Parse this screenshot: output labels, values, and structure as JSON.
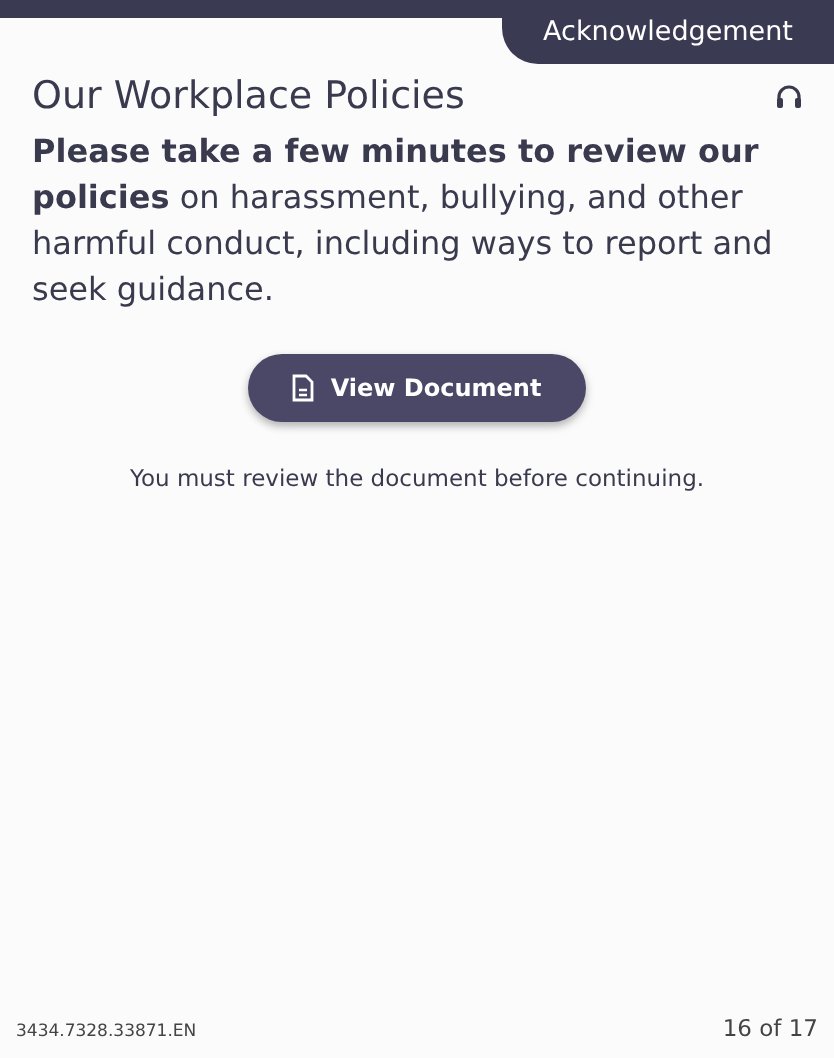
{
  "header": {
    "tab": "Acknowledgement"
  },
  "title": "Our Workplace Policies",
  "intro": "**Please take a few minutes to review our policies** on harassment, bullying, and other harmful conduct, including ways to report and seek guidance.",
  "button": {
    "label": "View Document"
  },
  "notice": "You must review the document before continuing.",
  "footer": {
    "code": "3434.7328.33871.EN",
    "page": "16 of 17"
  }
}
